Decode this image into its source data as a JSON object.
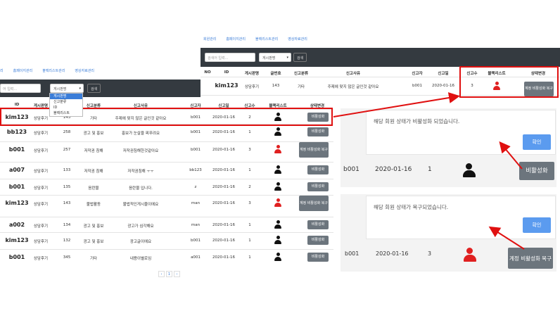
{
  "nav": [
    "회원관리",
    "홈페이지관리",
    "블랙리스트관리",
    "영상자료관리"
  ],
  "left_nav": [
    "리",
    "홈페이지관리",
    "블랙리스트관리",
    "영상자료관리"
  ],
  "search": {
    "placeholder": "검색어 입력...",
    "left_placeholder": "어 입력...",
    "select_value": "게시판명",
    "button": "검색"
  },
  "dropdown": [
    "게시판명",
    "신고분류",
    "ID",
    "블랙리스트"
  ],
  "left_table": {
    "headers": [
      "ID",
      "게시판명",
      "글번호",
      "신고분류",
      "신고사유",
      "신고자",
      "신고일",
      "신고수",
      "블랙리스트",
      "상태변경"
    ],
    "rows": [
      {
        "id": "kim123",
        "board": "상담후기",
        "no": "143",
        "cat": "기타",
        "reason": "주제에 맞지 않은 글인것 같아요",
        "reporter": "b001",
        "date": "2020-01-16",
        "count": "2",
        "black": "black",
        "action": "비활성화"
      },
      {
        "id": "bb123",
        "board": "상담후기",
        "no": "258",
        "cat": "광고 및 홍보",
        "reason": "홍보가 눈살을 찌푸려요",
        "reporter": "b001",
        "date": "2020-01-16",
        "count": "1",
        "black": "black",
        "action": "비활성화"
      },
      {
        "id": "b001",
        "board": "상담후기",
        "no": "257",
        "cat": "저작권 침해",
        "reason": "저작권침해한것같아요",
        "reporter": "b001",
        "date": "2020-01-16",
        "count": "3",
        "black": "red",
        "action": "계정 비활성화 복구"
      },
      {
        "id": "a007",
        "board": "상담후기",
        "no": "133",
        "cat": "저작권 침해",
        "reason": "저작권침해 ㅜㅜ",
        "reporter": "bb123",
        "date": "2020-01-16",
        "count": "1",
        "black": "black",
        "action": "비활성화"
      },
      {
        "id": "b001",
        "board": "상담후기",
        "no": "135",
        "cat": "음란물",
        "reason": "음란물 입니다.",
        "reporter": "z",
        "date": "2020-01-16",
        "count": "2",
        "black": "black",
        "action": "비활성화"
      },
      {
        "id": "kim123",
        "board": "상담후기",
        "no": "143",
        "cat": "불법활동",
        "reason": "불법적인게시물이에요",
        "reporter": "man",
        "date": "2020-01-16",
        "count": "3",
        "black": "red",
        "action": "계정 비활성화 복구"
      },
      {
        "id": "a002",
        "board": "상담후기",
        "no": "134",
        "cat": "광고 및 홍보",
        "reason": "광고가 심각해요",
        "reporter": "man",
        "date": "2020-01-16",
        "count": "1",
        "black": "black",
        "action": "비활성화"
      },
      {
        "id": "kim123",
        "board": "상담후기",
        "no": "132",
        "cat": "광고 및 홍보",
        "reason": "광고글이에요",
        "reporter": "b001",
        "date": "2020-01-16",
        "count": "1",
        "black": "black",
        "action": "비활성화"
      },
      {
        "id": "b001",
        "board": "상담후기",
        "no": "345",
        "cat": "기타",
        "reason": "내용이별로임",
        "reporter": "a001",
        "date": "2020-01-16",
        "count": "1",
        "black": "black",
        "action": "비활성화"
      }
    ]
  },
  "pager": [
    "‹",
    "1",
    "›"
  ],
  "top_table": {
    "headers": [
      "NO",
      "ID",
      "게시판명",
      "글번호",
      "신고분류",
      "신고사유",
      "신고자",
      "신고일",
      "신고수",
      "블랙리스트",
      "상태변경"
    ],
    "row": {
      "id": "kim123",
      "board": "상담후기",
      "no": "143",
      "cat": "기타",
      "reason": "주제에 맞지 않은 글인것 같아요",
      "reporter": "b001",
      "date": "2020-01-16",
      "count": "3",
      "action": "계정 비활성화 복구"
    }
  },
  "dialog1": {
    "message": "해당 회원 상태가 비활성화 되었습니다.",
    "confirm": "확인",
    "strip": {
      "id": "b001",
      "date": "2020-01-16",
      "count": "1",
      "action": "비활성화"
    }
  },
  "dialog2": {
    "message": "해당 회원 상태가 복구되었습니다.",
    "confirm": "확인",
    "strip": {
      "id": "b001",
      "date": "2020-01-16",
      "count": "3",
      "action": "계정 비활성화 복구"
    }
  },
  "colors": {
    "dark_bar": "#343a40",
    "highlight": "#e01010",
    "link": "#3b7dd8",
    "confirm": "#5b9bef",
    "gray_button": "#6c757d",
    "red_icon": "#e02020"
  }
}
